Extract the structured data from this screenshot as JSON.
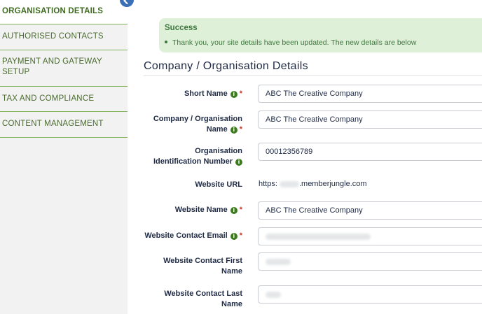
{
  "sidebar": {
    "items": [
      {
        "label": "ORGANISATION DETAILS"
      },
      {
        "label": "AUTHORISED CONTACTS"
      },
      {
        "label": "PAYMENT AND GATEWAY SETUP"
      },
      {
        "label": "TAX AND COMPLIANCE"
      },
      {
        "label": "CONTENT MANAGEMENT"
      }
    ]
  },
  "alert": {
    "title": "Success",
    "message": "Thank you, your site details have been updated. The new details are below"
  },
  "section": {
    "title": "Company / Organisation Details"
  },
  "form": {
    "short_name": {
      "label": "Short Name",
      "value": "ABC The Creative Company"
    },
    "company_name": {
      "label_line1": "Company / Organisation",
      "label_line2": "Name",
      "value": "ABC The Creative Company"
    },
    "org_id": {
      "label_line1": "Organisation",
      "label_line2": "Identification Number",
      "value": "00012356789"
    },
    "website_url": {
      "label": "Website URL",
      "prefix": "https:",
      "suffix": ".memberjungle.com"
    },
    "website_name": {
      "label": "Website Name",
      "value": "ABC The Creative Company"
    },
    "contact_email": {
      "label": "Website Contact Email"
    },
    "contact_first": {
      "label_line1": "Website Contact First",
      "label_line2": "Name"
    },
    "contact_last": {
      "label_line1": "Website Contact Last",
      "label_line2": "Name"
    }
  },
  "icons": {
    "info": "info-icon",
    "required": "*"
  }
}
